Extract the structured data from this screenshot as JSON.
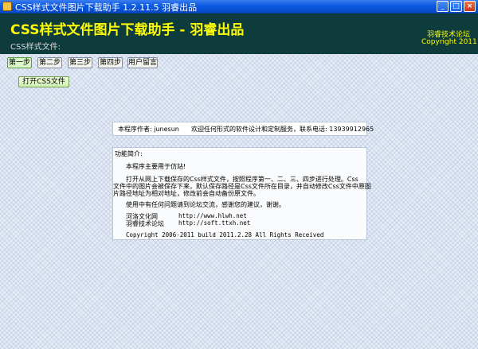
{
  "window": {
    "title": "CSS样式文件图片下载助手 1.2.11.5  羽睿出品",
    "min_glyph": "_",
    "max_glyph": "□",
    "close_glyph": "×"
  },
  "header": {
    "title": "CSS样式文件图片下载助手 - 羽睿出品",
    "css_file_label": "CSS样式文件:",
    "forum": "羽睿技术论坛",
    "copyright": "Copyright 2011"
  },
  "tabs": [
    {
      "label": "第一步",
      "active": true
    },
    {
      "label": "第二步",
      "active": false
    },
    {
      "label": "第三步",
      "active": false
    },
    {
      "label": "第四步",
      "active": false
    },
    {
      "label": "用户留言",
      "active": false
    }
  ],
  "open_button": "打开CSS文件",
  "author_bar": {
    "author": "本程序作者: junesun",
    "welcome": "欢迎任何形式的软件设计和定制服务，联系电话: 13939912965"
  },
  "intro": {
    "heading": "功能简介:",
    "line1": "本程序主要用于仿站!",
    "para1": "打开从网上下载保存的Css样式文件，按照程序第一、二、三、四步进行处理。Css",
    "para2": "文件中的图片会被保存下来，默认保存路径是Css文件所在目录，并自动修改Css文件中原图",
    "para3": "片路径地址为相对地址，修改前会自动备份原文件。",
    "contact": "使用中有任何问题请到论坛交流，感谢您的建议，谢谢。",
    "links": [
      {
        "name": "河洛文化网",
        "url": "http://www.hlwh.net"
      },
      {
        "name": "羽睿技术论坛",
        "url": "http://soft.ttxh.net"
      }
    ],
    "copyright": "Copyright 2006-2011  build 2011.2.28  All Rights Received"
  },
  "colors": {
    "header_bg": "#0e3c3c",
    "title_yellow": "#ffff00",
    "active_tab": "#d9f6c8"
  }
}
